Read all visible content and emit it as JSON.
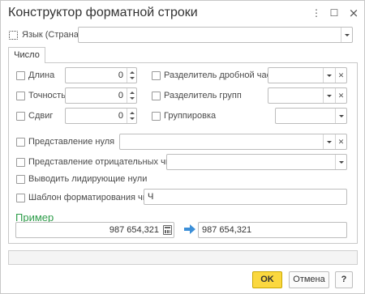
{
  "window": {
    "title": "Конструктор форматной строки",
    "more_icon": "⋮",
    "maximize_icon": "☐",
    "close_icon": "×"
  },
  "language": {
    "label": "Язык (Страна)",
    "value": "",
    "checked": false
  },
  "tabs": [
    {
      "label": "Число",
      "active": true
    }
  ],
  "number": {
    "length": {
      "label": "Длина",
      "value": "0",
      "checked": false
    },
    "precision": {
      "label": "Точность",
      "value": "0",
      "checked": false
    },
    "shift": {
      "label": "Сдвиг",
      "value": "0",
      "checked": false
    },
    "decimal_separator": {
      "label": "Разделитель дробной части",
      "value": "",
      "checked": false
    },
    "group_separator": {
      "label": "Разделитель групп",
      "value": "",
      "checked": false
    },
    "grouping": {
      "label": "Группировка",
      "value": "",
      "checked": false
    },
    "zero_representation": {
      "label": "Представление нуля",
      "value": "",
      "checked": false
    },
    "negative_representation": {
      "label": "Представление отрицательных чисел",
      "value": "",
      "checked": false
    },
    "leading_zeros": {
      "label": "Выводить лидирующие нули",
      "checked": false
    },
    "format_pattern": {
      "label": "Шаблон форматирования числа",
      "value": "Ч",
      "checked": false
    }
  },
  "example": {
    "label": "Пример",
    "input_value": "987 654,321",
    "output_value": "987 654,321"
  },
  "status_text": "",
  "buttons": {
    "ok": "OK",
    "cancel": "Отмена",
    "help": "?"
  },
  "colors": {
    "accent_green": "#2e9d4a",
    "ok_button": "#fbd83f",
    "arrow_blue": "#3c8fd8"
  }
}
